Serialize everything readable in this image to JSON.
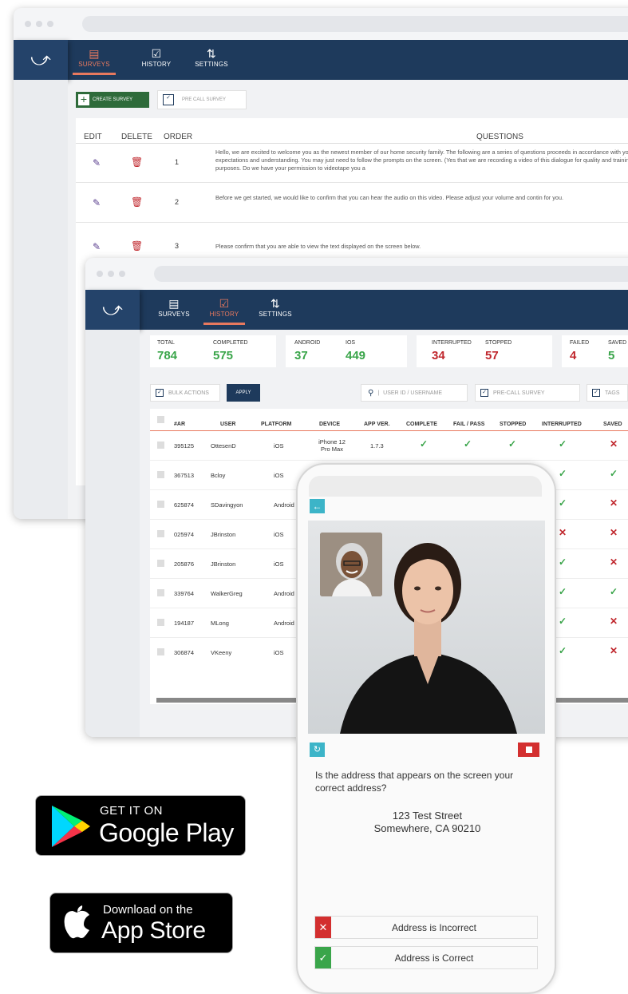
{
  "app_windows": {
    "surveys_window": {
      "nav": {
        "surveys": "SURVEYS",
        "history": "HISTORY",
        "settings": "SETTINGS"
      },
      "toolbar": {
        "create_survey": "CREATE SURVEY",
        "pre_call_survey": "PRE CALL SURVEY"
      },
      "table": {
        "headers": {
          "edit": "EDIT",
          "delete": "DELETE",
          "order": "ORDER",
          "questions": "QUESTIONS"
        },
        "rows": [
          {
            "order": "1",
            "question": "Hello, we are excited to welcome you as the newest member of our home security family. The following are a series of questions proceeds in accordance with your expectations and understanding. You may just need to follow the prompts on the screen. (Yes that we are recording a video of this dialogue for quality and training purposes. Do we have your permission to videotape you a"
          },
          {
            "order": "2",
            "question": "Before we get started, we would like to confirm that you can hear the audio on this video.  Please adjust your volume and contin for you."
          },
          {
            "order": "3",
            "question": "Please confirm that you are able to view the text displayed on the screen below."
          }
        ]
      }
    },
    "history_window": {
      "nav": {
        "surveys": "SURVEYS",
        "history": "HISTORY",
        "settings": "SETTINGS"
      },
      "stats": {
        "total_label": "TOTAL",
        "total": "784",
        "completed_label": "COMPLETED",
        "completed": "575",
        "android_label": "ANDROID",
        "android": "37",
        "ios_label": "IOS",
        "ios": "449",
        "interrupted_label": "INTERRUPTED",
        "interrupted": "34",
        "stopped_label": "STOPPED",
        "stopped": "57",
        "failed_label": "FAILED",
        "failed": "4",
        "saved_label": "SAVED",
        "saved": "5"
      },
      "toolbar": {
        "bulk_actions": "BULK ACTIONS",
        "apply": "APPLY",
        "search_placeholder": "USER ID / USERNAME",
        "pre_call_survey": "PRE-CALL SURVEY",
        "tags": "TAGS"
      },
      "table": {
        "headers": {
          "id": "#AR",
          "user": "USER",
          "platform": "PLATFORM",
          "device": "DEVICE",
          "app_ver": "APP VER.",
          "complete": "COMPLETE",
          "fail_pass": "FAIL / PASS",
          "stopped": "STOPPED",
          "interrupted": "INTERRUPTED",
          "saved": "SAVED"
        },
        "rows": [
          {
            "id": "395125",
            "user": "OttesenD",
            "platform": "iOS",
            "device": "iPhone 12 Pro Max",
            "app_ver": "1.7.3"
          },
          {
            "id": "367513",
            "user": "Bcloy",
            "platform": "iOS"
          },
          {
            "id": "625874",
            "user": "SDavingyon",
            "platform": "Android"
          },
          {
            "id": "025974",
            "user": "JBrinston",
            "platform": "iOS"
          },
          {
            "id": "205876",
            "user": "JBrinston",
            "platform": "iOS"
          },
          {
            "id": "339764",
            "user": "WalkerGreg",
            "platform": "Android"
          },
          {
            "id": "194187",
            "user": "MLong",
            "platform": "Android"
          },
          {
            "id": "306874",
            "user": "VKeeny",
            "platform": "iOS"
          }
        ]
      }
    }
  },
  "phone": {
    "question": "Is the address that appears on the screen your correct address?",
    "address_line1": "123 Test Street",
    "address_line2": "Somewhere, CA 90210",
    "answer_incorrect": "Address is Incorrect",
    "answer_correct": "Address is Correct"
  },
  "badges": {
    "google_small": "GET IT ON",
    "google_big": "Google Play",
    "apple_small": "Download on the",
    "apple_big": "App Store"
  },
  "colors": {
    "navy": "#1e3a5c",
    "accent": "#e8795e",
    "green": "#3aa54a",
    "red": "#c0272d",
    "teal": "#3cb4c8"
  }
}
